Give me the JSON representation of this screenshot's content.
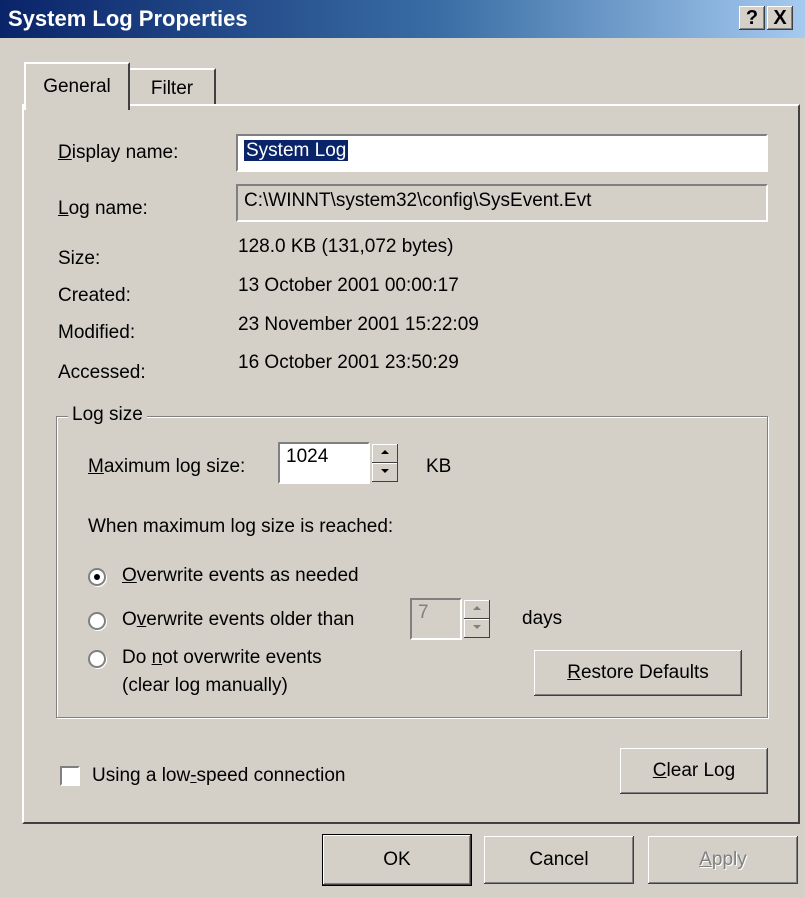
{
  "window": {
    "title": "System Log Properties"
  },
  "titlebar": {
    "help_label": "?",
    "close_label": "X"
  },
  "tabs": [
    {
      "label": "General",
      "active": true
    },
    {
      "label": "Filter",
      "active": false
    }
  ],
  "general": {
    "display_name_label": "Display name:",
    "display_name_value": "System Log",
    "log_name_label": "Log name:",
    "log_name_value": "C:\\WINNT\\system32\\config\\SysEvent.Evt",
    "size_label": "Size:",
    "size_value": "128.0 KB (131,072 bytes)",
    "created_label": "Created:",
    "created_value": "13 October 2001 00:00:17",
    "modified_label": "Modified:",
    "modified_value": "23 November 2001 15:22:09",
    "accessed_label": "Accessed:",
    "accessed_value": "16 October 2001 23:50:29"
  },
  "log_size": {
    "group_label": "Log size",
    "max_size_label": "Maximum log size:",
    "max_size_value": "1024",
    "max_size_unit": "KB",
    "reached_label": "When maximum log size is reached:",
    "options": [
      {
        "label": "Overwrite events as needed",
        "selected": true
      },
      {
        "label": "Overwrite events older than",
        "selected": false
      },
      {
        "label_line1": "Do not overwrite events",
        "label_line2": "(clear log manually)",
        "selected": false
      }
    ],
    "days_value": "7",
    "days_unit": "days",
    "restore_defaults_label": "Restore Defaults"
  },
  "low_speed": {
    "label": "Using a low-speed connection",
    "checked": false
  },
  "clear_log_label": "Clear Log",
  "footer": {
    "ok_label": "OK",
    "cancel_label": "Cancel",
    "apply_label": "Apply"
  },
  "colors": {
    "title_start": "#0a246a",
    "title_end": "#a6caf0",
    "face": "#d4d0c8",
    "selection": "#0a246a"
  }
}
